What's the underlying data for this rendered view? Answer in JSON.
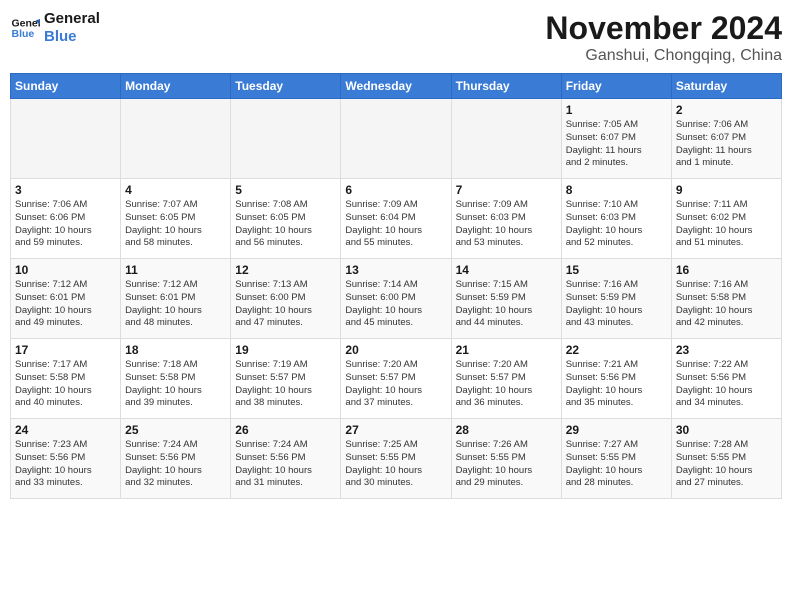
{
  "logo": {
    "line1": "General",
    "line2": "Blue"
  },
  "title": "November 2024",
  "location": "Ganshui, Chongqing, China",
  "weekdays": [
    "Sunday",
    "Monday",
    "Tuesday",
    "Wednesday",
    "Thursday",
    "Friday",
    "Saturday"
  ],
  "weeks": [
    [
      {
        "day": "",
        "info": ""
      },
      {
        "day": "",
        "info": ""
      },
      {
        "day": "",
        "info": ""
      },
      {
        "day": "",
        "info": ""
      },
      {
        "day": "",
        "info": ""
      },
      {
        "day": "1",
        "info": "Sunrise: 7:05 AM\nSunset: 6:07 PM\nDaylight: 11 hours\nand 2 minutes."
      },
      {
        "day": "2",
        "info": "Sunrise: 7:06 AM\nSunset: 6:07 PM\nDaylight: 11 hours\nand 1 minute."
      }
    ],
    [
      {
        "day": "3",
        "info": "Sunrise: 7:06 AM\nSunset: 6:06 PM\nDaylight: 10 hours\nand 59 minutes."
      },
      {
        "day": "4",
        "info": "Sunrise: 7:07 AM\nSunset: 6:05 PM\nDaylight: 10 hours\nand 58 minutes."
      },
      {
        "day": "5",
        "info": "Sunrise: 7:08 AM\nSunset: 6:05 PM\nDaylight: 10 hours\nand 56 minutes."
      },
      {
        "day": "6",
        "info": "Sunrise: 7:09 AM\nSunset: 6:04 PM\nDaylight: 10 hours\nand 55 minutes."
      },
      {
        "day": "7",
        "info": "Sunrise: 7:09 AM\nSunset: 6:03 PM\nDaylight: 10 hours\nand 53 minutes."
      },
      {
        "day": "8",
        "info": "Sunrise: 7:10 AM\nSunset: 6:03 PM\nDaylight: 10 hours\nand 52 minutes."
      },
      {
        "day": "9",
        "info": "Sunrise: 7:11 AM\nSunset: 6:02 PM\nDaylight: 10 hours\nand 51 minutes."
      }
    ],
    [
      {
        "day": "10",
        "info": "Sunrise: 7:12 AM\nSunset: 6:01 PM\nDaylight: 10 hours\nand 49 minutes."
      },
      {
        "day": "11",
        "info": "Sunrise: 7:12 AM\nSunset: 6:01 PM\nDaylight: 10 hours\nand 48 minutes."
      },
      {
        "day": "12",
        "info": "Sunrise: 7:13 AM\nSunset: 6:00 PM\nDaylight: 10 hours\nand 47 minutes."
      },
      {
        "day": "13",
        "info": "Sunrise: 7:14 AM\nSunset: 6:00 PM\nDaylight: 10 hours\nand 45 minutes."
      },
      {
        "day": "14",
        "info": "Sunrise: 7:15 AM\nSunset: 5:59 PM\nDaylight: 10 hours\nand 44 minutes."
      },
      {
        "day": "15",
        "info": "Sunrise: 7:16 AM\nSunset: 5:59 PM\nDaylight: 10 hours\nand 43 minutes."
      },
      {
        "day": "16",
        "info": "Sunrise: 7:16 AM\nSunset: 5:58 PM\nDaylight: 10 hours\nand 42 minutes."
      }
    ],
    [
      {
        "day": "17",
        "info": "Sunrise: 7:17 AM\nSunset: 5:58 PM\nDaylight: 10 hours\nand 40 minutes."
      },
      {
        "day": "18",
        "info": "Sunrise: 7:18 AM\nSunset: 5:58 PM\nDaylight: 10 hours\nand 39 minutes."
      },
      {
        "day": "19",
        "info": "Sunrise: 7:19 AM\nSunset: 5:57 PM\nDaylight: 10 hours\nand 38 minutes."
      },
      {
        "day": "20",
        "info": "Sunrise: 7:20 AM\nSunset: 5:57 PM\nDaylight: 10 hours\nand 37 minutes."
      },
      {
        "day": "21",
        "info": "Sunrise: 7:20 AM\nSunset: 5:57 PM\nDaylight: 10 hours\nand 36 minutes."
      },
      {
        "day": "22",
        "info": "Sunrise: 7:21 AM\nSunset: 5:56 PM\nDaylight: 10 hours\nand 35 minutes."
      },
      {
        "day": "23",
        "info": "Sunrise: 7:22 AM\nSunset: 5:56 PM\nDaylight: 10 hours\nand 34 minutes."
      }
    ],
    [
      {
        "day": "24",
        "info": "Sunrise: 7:23 AM\nSunset: 5:56 PM\nDaylight: 10 hours\nand 33 minutes."
      },
      {
        "day": "25",
        "info": "Sunrise: 7:24 AM\nSunset: 5:56 PM\nDaylight: 10 hours\nand 32 minutes."
      },
      {
        "day": "26",
        "info": "Sunrise: 7:24 AM\nSunset: 5:56 PM\nDaylight: 10 hours\nand 31 minutes."
      },
      {
        "day": "27",
        "info": "Sunrise: 7:25 AM\nSunset: 5:55 PM\nDaylight: 10 hours\nand 30 minutes."
      },
      {
        "day": "28",
        "info": "Sunrise: 7:26 AM\nSunset: 5:55 PM\nDaylight: 10 hours\nand 29 minutes."
      },
      {
        "day": "29",
        "info": "Sunrise: 7:27 AM\nSunset: 5:55 PM\nDaylight: 10 hours\nand 28 minutes."
      },
      {
        "day": "30",
        "info": "Sunrise: 7:28 AM\nSunset: 5:55 PM\nDaylight: 10 hours\nand 27 minutes."
      }
    ]
  ]
}
